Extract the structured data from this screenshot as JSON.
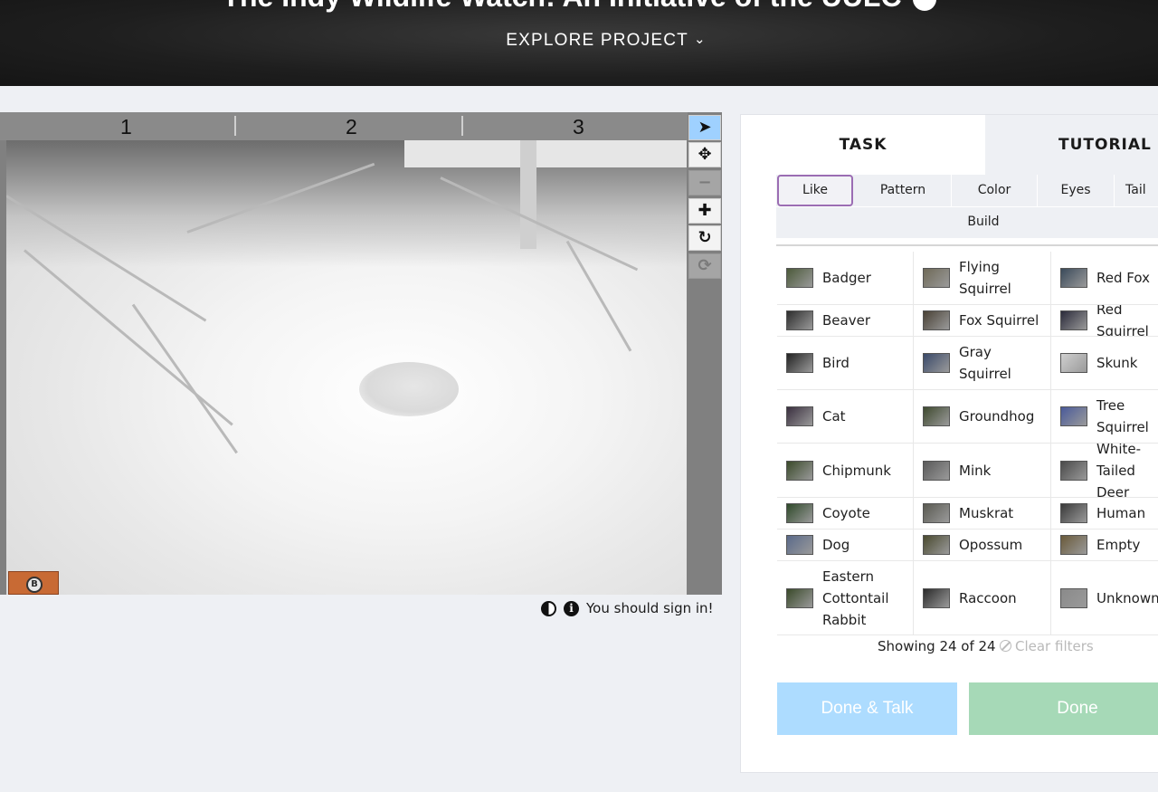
{
  "header": {
    "title": "The Indy Wildlife Watch: An Initiative of the UULC",
    "explore_label": "EXPLORE PROJECT",
    "explore_chevron": "⌄"
  },
  "viewer": {
    "ruler": [
      "1",
      "2",
      "3"
    ],
    "tools": [
      {
        "name": "pointer-tool-button",
        "icon": "arrow-pointer-icon",
        "glyph": "➤",
        "active": true,
        "disabled": false
      },
      {
        "name": "move-tool-button",
        "icon": "move-arrows-icon",
        "glyph": "✥",
        "active": false,
        "disabled": false
      },
      {
        "name": "zoom-out-button",
        "icon": "minus-icon",
        "glyph": "−",
        "active": false,
        "disabled": true
      },
      {
        "name": "zoom-in-button",
        "icon": "plus-icon",
        "glyph": "✚",
        "active": false,
        "disabled": false
      },
      {
        "name": "rotate-button",
        "icon": "rotate-icon",
        "glyph": "↻",
        "active": false,
        "disabled": false
      },
      {
        "name": "reset-button",
        "icon": "refresh-icon",
        "glyph": "⟳",
        "active": false,
        "disabled": true
      }
    ],
    "badge_glyph": "B",
    "sign_in_text": "You should sign in!"
  },
  "panel": {
    "tabs": {
      "task": "TASK",
      "tutorial": "TUTORIAL"
    },
    "filters": [
      "Like",
      "Pattern",
      "Color",
      "Eyes",
      "Tail",
      "Build"
    ],
    "selected_filter": "Like",
    "choices": [
      [
        "Badger",
        "Flying Squirrel",
        "Red Fox"
      ],
      [
        "Beaver",
        "Fox Squirrel",
        "Red Squirrel"
      ],
      [
        "Bird",
        "Gray Squirrel",
        "Skunk"
      ],
      [
        "Cat",
        "Groundhog",
        "Tree Squirrel"
      ],
      [
        "Chipmunk",
        "Mink",
        "White-Tailed Deer"
      ],
      [
        "Coyote",
        "Muskrat",
        "Human"
      ],
      [
        "Dog",
        "Opossum",
        "Empty"
      ],
      [
        "Eastern Cottontail Rabbit",
        "Raccoon",
        "Unknown"
      ]
    ],
    "showing_text": "Showing 24 of 24",
    "clear_filters": "Clear filters",
    "done_talk": "Done & Talk",
    "done": "Done"
  },
  "colors": {
    "accent_selected": "#9b6db3",
    "done_talk_bg": "#addcff",
    "done_bg": "#a6d9b7",
    "active_tool": "#9fd1ff"
  }
}
